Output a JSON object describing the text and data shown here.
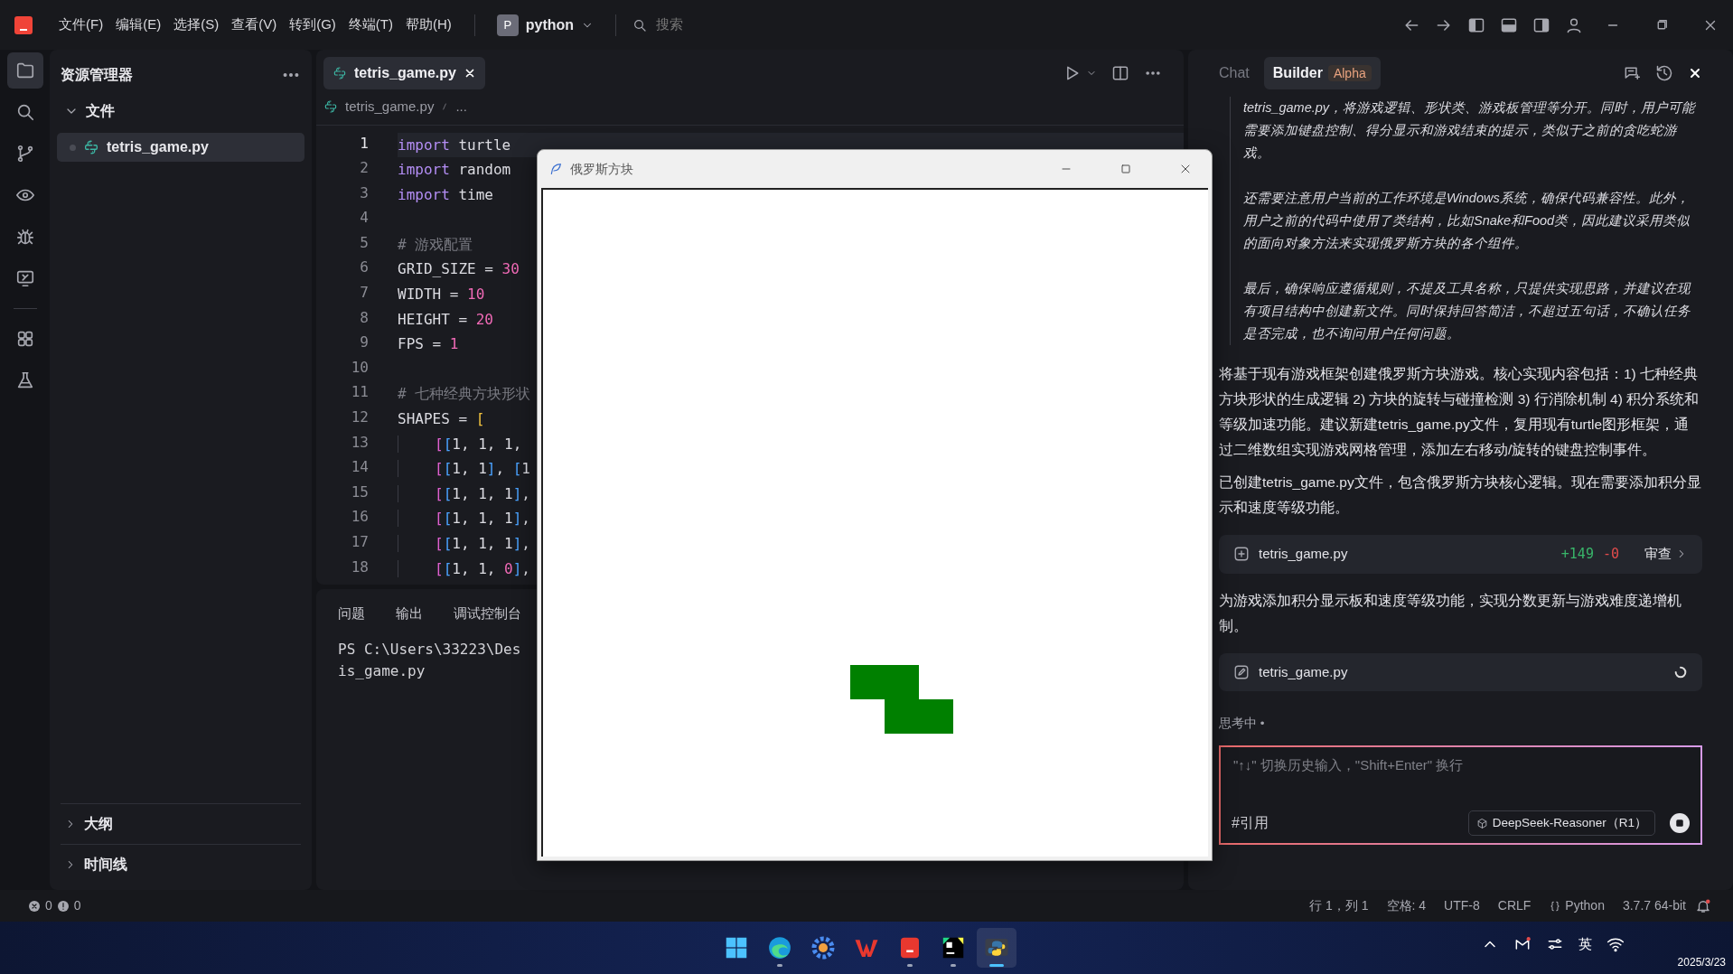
{
  "title_bar": {
    "menus": [
      "文件(F)",
      "编辑(E)",
      "选择(S)",
      "查看(V)",
      "转到(G)",
      "终端(T)",
      "帮助(H)"
    ],
    "project": {
      "initial": "P",
      "name": "python"
    },
    "search": {
      "placeholder": "搜索"
    }
  },
  "activity_bar": {
    "items": [
      {
        "kind": "files",
        "selected": true
      },
      {
        "kind": "search",
        "selected": false
      },
      {
        "kind": "branch",
        "selected": false
      },
      {
        "kind": "eye",
        "selected": false
      },
      {
        "kind": "bug",
        "selected": false
      },
      {
        "kind": "remote",
        "selected": false
      },
      {
        "kind": "apps",
        "selected": false
      },
      {
        "kind": "flask",
        "selected": false
      }
    ]
  },
  "explorer": {
    "title": "资源管理器",
    "folder": {
      "label": "文件",
      "expanded": true,
      "children": [
        {
          "label": "tetris_game.py",
          "selected": true
        }
      ]
    },
    "sections": [
      {
        "label": "大纲",
        "expanded": false
      },
      {
        "label": "时间线",
        "expanded": false
      }
    ]
  },
  "editor": {
    "tabs": [
      {
        "label": "tetris_game.py",
        "selected": true
      }
    ],
    "breadcrumb": [
      "tetris_game.py",
      "..."
    ],
    "lines": [
      {
        "number": "1",
        "current": true,
        "indented": false,
        "tokens": [
          {
            "kind": "kw",
            "text": "import"
          },
          {
            "kind": "id",
            "text": " turtle"
          }
        ]
      },
      {
        "number": "2",
        "current": false,
        "indented": false,
        "tokens": [
          {
            "kind": "kw",
            "text": "import"
          },
          {
            "kind": "id",
            "text": " random"
          }
        ]
      },
      {
        "number": "3",
        "current": false,
        "indented": false,
        "tokens": [
          {
            "kind": "kw",
            "text": "import"
          },
          {
            "kind": "id",
            "text": " time"
          }
        ]
      },
      {
        "number": "4",
        "current": false
      },
      {
        "number": "5",
        "current": false,
        "indented": false,
        "tokens": [
          {
            "kind": "cm",
            "text": "# 游戏配置"
          }
        ]
      },
      {
        "number": "6",
        "current": false,
        "indented": false,
        "tokens": [
          {
            "kind": "id",
            "text": "GRID_SIZE = "
          },
          {
            "kind": "num",
            "text": "30"
          }
        ]
      },
      {
        "number": "7",
        "current": false,
        "indented": false,
        "tokens": [
          {
            "kind": "id",
            "text": "WIDTH = "
          },
          {
            "kind": "num",
            "text": "10"
          }
        ]
      },
      {
        "number": "8",
        "current": false,
        "indented": false,
        "tokens": [
          {
            "kind": "id",
            "text": "HEIGHT = "
          },
          {
            "kind": "num",
            "text": "20"
          }
        ]
      },
      {
        "number": "9",
        "current": false,
        "indented": false,
        "tokens": [
          {
            "kind": "id",
            "text": "FPS = "
          },
          {
            "kind": "num",
            "text": "1"
          }
        ]
      },
      {
        "number": "10",
        "current": false
      },
      {
        "number": "11",
        "current": false,
        "indented": false,
        "tokens": [
          {
            "kind": "cm",
            "text": "# 七种经典方块形状"
          }
        ]
      },
      {
        "number": "12",
        "current": false,
        "indented": false,
        "tokens": [
          {
            "kind": "id",
            "text": "SHAPES = "
          },
          {
            "kind": "b1",
            "text": "["
          }
        ]
      },
      {
        "number": "13",
        "current": false,
        "indented": true,
        "tokens": [
          {
            "kind": "b2",
            "text": "["
          },
          {
            "kind": "b3",
            "text": "["
          },
          {
            "kind": "id",
            "text": "1, 1, 1,"
          }
        ]
      },
      {
        "number": "14",
        "current": false,
        "indented": true,
        "tokens": [
          {
            "kind": "b2",
            "text": "["
          },
          {
            "kind": "b3",
            "text": "["
          },
          {
            "kind": "id",
            "text": "1, 1"
          },
          {
            "kind": "b3",
            "text": "]"
          },
          {
            "kind": "id",
            "text": ", "
          },
          {
            "kind": "b3",
            "text": "["
          },
          {
            "kind": "id",
            "text": "1"
          }
        ]
      },
      {
        "number": "15",
        "current": false,
        "indented": true,
        "tokens": [
          {
            "kind": "b2",
            "text": "["
          },
          {
            "kind": "b3",
            "text": "["
          },
          {
            "kind": "id",
            "text": "1, 1, 1"
          },
          {
            "kind": "b3",
            "text": "]"
          },
          {
            "kind": "id",
            "text": ","
          }
        ]
      },
      {
        "number": "16",
        "current": false,
        "indented": true,
        "tokens": [
          {
            "kind": "b2",
            "text": "["
          },
          {
            "kind": "b3",
            "text": "["
          },
          {
            "kind": "id",
            "text": "1, 1, 1"
          },
          {
            "kind": "b3",
            "text": "]"
          },
          {
            "kind": "id",
            "text": ","
          }
        ]
      },
      {
        "number": "17",
        "current": false,
        "indented": true,
        "tokens": [
          {
            "kind": "b2",
            "text": "["
          },
          {
            "kind": "b3",
            "text": "["
          },
          {
            "kind": "id",
            "text": "1, 1, 1"
          },
          {
            "kind": "b3",
            "text": "]"
          },
          {
            "kind": "id",
            "text": ","
          }
        ]
      },
      {
        "number": "18",
        "current": false,
        "indented": true,
        "tokens": [
          {
            "kind": "b2",
            "text": "["
          },
          {
            "kind": "b3",
            "text": "["
          },
          {
            "kind": "id",
            "text": "1, 1, "
          },
          {
            "kind": "num",
            "text": "0"
          },
          {
            "kind": "b3",
            "text": "]"
          },
          {
            "kind": "id",
            "text": ","
          }
        ]
      }
    ]
  },
  "panel": {
    "tabs": [
      "问题",
      "输出",
      "调试控制台"
    ],
    "terminal_lines": [
      "PS C:\\Users\\33223\\Des",
      "is_game.py"
    ]
  },
  "tetris_window": {
    "title": "俄罗斯方块"
  },
  "assistant": {
    "tabs": [
      {
        "label": "Chat",
        "selected": false
      },
      {
        "label": "Builder",
        "selected": true,
        "badge": "Alpha"
      }
    ],
    "thinking": [
      "tetris_game.py，将游戏逻辑、形状类、游戏板管理等分开。同时，用户可能需要添加键盘控制、得分显示和游戏结束的提示，类似于之前的贪吃蛇游戏。",
      "还需要注意用户当前的工作环境是Windows系统，确保代码兼容性。此外，用户之前的代码中使用了类结构，比如Snake和Food类，因此建议采用类似的面向对象方法来实现俄罗斯方块的各个组件。",
      "最后，确保响应遵循规则，不提及工具名称，只提供实现思路，并建议在现有项目结构中创建新文件。同时保持回答简洁，不超过五句话，不确认任务是否完成，也不询问用户任何问题。"
    ],
    "messages": [
      {
        "kind": "text",
        "text": "将基于现有游戏框架创建俄罗斯方块游戏。核心实现内容包括：1) 七种经典方块形状的生成逻辑 2) 方块的旋转与碰撞检测 3) 行消除机制 4) 积分系统和等级加速功能。建议新建tetris_game.py文件，复用现有turtle图形框架，通过二维数组实现游戏网格管理，添加左右移动/旋转的键盘控制事件。"
      },
      {
        "kind": "text",
        "text": "已创建tetris_game.py文件，包含俄罗斯方块核心逻辑。现在需要添加积分显示和速度等级功能。"
      },
      {
        "kind": "new_file",
        "name": "tetris_game.py",
        "running": false,
        "added": "+149",
        "removed": "-0",
        "action": "审查"
      },
      {
        "kind": "text",
        "text": "为游戏添加积分显示板和速度等级功能，实现分数更新与游戏难度递增机制。"
      },
      {
        "kind": "edited_file",
        "name": "tetris_game.py",
        "running": true
      }
    ],
    "status": "思考中 •",
    "input": {
      "placeholder": "\"↑↓\" 切换历史输入，\"Shift+Enter\" 换行",
      "reference": "#引用",
      "model": "DeepSeek-Reasoner（R1）"
    }
  },
  "status_bar": {
    "errors": "0",
    "warnings": "0",
    "items": [
      {
        "kind": "text",
        "text": "行 1，列 1"
      },
      {
        "kind": "text",
        "text": "空格: 4"
      },
      {
        "kind": "text",
        "text": "UTF-8"
      },
      {
        "kind": "text",
        "text": "CRLF"
      },
      {
        "kind": "language",
        "text": "Python"
      },
      {
        "kind": "text",
        "text": "3.7.7 64-bit"
      }
    ]
  },
  "taskbar": {
    "apps": [
      {
        "kind": "start",
        "running": false,
        "active": false
      },
      {
        "kind": "edge",
        "running": true,
        "active": false
      },
      {
        "kind": "gear",
        "running": false,
        "active": false
      },
      {
        "kind": "wps",
        "running": false,
        "active": false
      },
      {
        "kind": "pdf",
        "running": true,
        "active": false
      },
      {
        "kind": "pycharm",
        "running": true,
        "active": false
      },
      {
        "kind": "python",
        "running": true,
        "active": true
      }
    ],
    "input_method": "英",
    "date": "2025/3/23"
  }
}
